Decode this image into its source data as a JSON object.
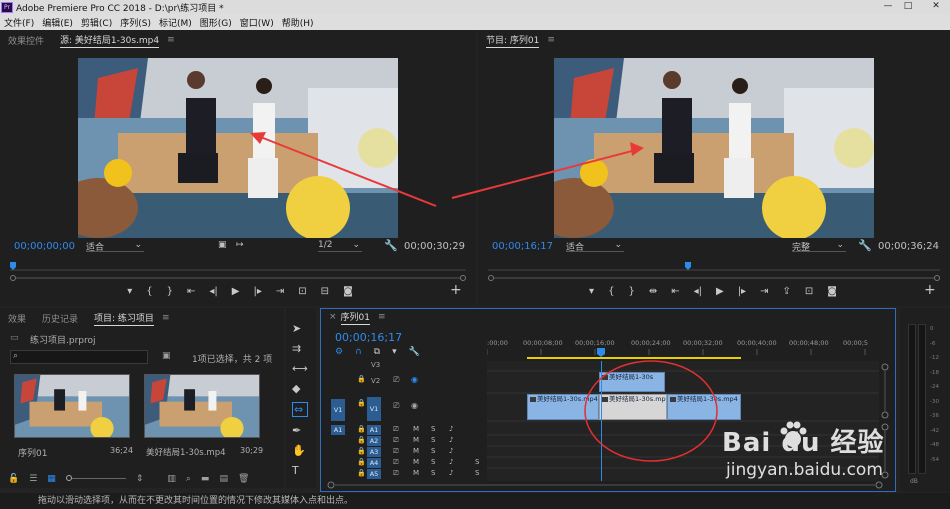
{
  "window": {
    "title": "Adobe Premiere Pro CC 2018 - D:\\pr\\练习项目 *",
    "logo": "Pr",
    "minimize": "—",
    "maximize": "□",
    "close": "✕"
  },
  "menu": [
    "文件(F)",
    "编辑(E)",
    "剪辑(C)",
    "序列(S)",
    "标记(M)",
    "图形(G)",
    "窗口(W)",
    "帮助(H)"
  ],
  "source_monitor": {
    "tab_effects": "效果控件",
    "tab_source": "源: 美好结局1-30s.mp4",
    "menu_icon": "≡",
    "timecode": "00;00;00;00",
    "fit": "适合",
    "resolution": "1/2",
    "duration": "00;00;30;29"
  },
  "program_monitor": {
    "tab": "节目: 序列01",
    "menu_icon": "≡",
    "timecode": "00;00;16;17",
    "fit": "适合",
    "quality": "完整",
    "duration": "00;00;36;24"
  },
  "project_panel": {
    "tabs": [
      "效果",
      "历史记录",
      "项目: 练习项目"
    ],
    "menu_icon": "≡",
    "file": "练习项目.prproj",
    "selection_info": "1项已选择，共 2 项",
    "items": [
      {
        "name": "序列01",
        "duration": "36;24"
      },
      {
        "name": "美好结局1-30s.mp4",
        "duration": "30;29"
      }
    ]
  },
  "timeline": {
    "tab": "序列01",
    "close": "×",
    "menu_icon": "≡",
    "timecode": "00;00;16;17",
    "ruler": [
      ":00;00",
      "00;00;08;00",
      "00;00;16;00",
      "00;00;24;00",
      "00;00;32;00",
      "00;00;40;00",
      "00;00;48;00",
      "00;00;5"
    ],
    "video_tracks": [
      "V3",
      "V2",
      "V1"
    ],
    "source_patch_video": "V1",
    "source_patch_audio": "A1",
    "audio_tracks": [
      "A1",
      "A2",
      "A3",
      "A4",
      "A5"
    ],
    "mute": "M",
    "solo": "S",
    "clips": [
      {
        "track": "V2",
        "label": "美好结局1-30s",
        "selected": false
      },
      {
        "track": "V1",
        "label": "美好结局1-30s.mp4",
        "selected": false
      },
      {
        "track": "V1",
        "label": "美好结局1-30s.mp4",
        "selected": true
      },
      {
        "track": "V1",
        "label": "美好结局1-30s.mp4",
        "selected": false
      }
    ]
  },
  "audio_meter": {
    "labels": [
      "0",
      "-6",
      "-12",
      "-18",
      "-24",
      "-30",
      "-36",
      "-42",
      "-48",
      "-54"
    ],
    "unit": "dB"
  },
  "status_bar": {
    "text": "拖动以滑动选择项，从而在不更改其时间位置的情况下修改其媒体入点和出点。"
  },
  "watermark": {
    "brand": "Bai du 经验",
    "url": "jingyan.baidu.com"
  },
  "colors": {
    "accent": "#2d8ceb",
    "clip": "#8ab4e3",
    "annotation_arrow": "#e83a3a"
  }
}
